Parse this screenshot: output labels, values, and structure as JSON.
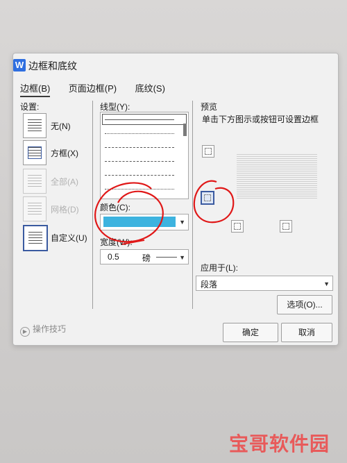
{
  "window": {
    "title": "边框和底纹",
    "app_icon": "W"
  },
  "tabs": [
    {
      "label": "边框(B)",
      "active": true
    },
    {
      "label": "页面边框(P)",
      "active": false
    },
    {
      "label": "底纹(S)",
      "active": false
    }
  ],
  "settings": {
    "heading": "设置:",
    "items": [
      {
        "label": "无(N)",
        "enabled": true,
        "selected": false
      },
      {
        "label": "方框(X)",
        "enabled": true,
        "selected": false
      },
      {
        "label": "全部(A)",
        "enabled": false,
        "selected": false
      },
      {
        "label": "网格(D)",
        "enabled": false,
        "selected": false
      },
      {
        "label": "自定义(U)",
        "enabled": true,
        "selected": true
      }
    ]
  },
  "line_style": {
    "heading": "线型(Y):",
    "selected_index": 0
  },
  "color": {
    "label": "颜色(C):",
    "value_hex": "#3db3df"
  },
  "width": {
    "label": "宽度(W):",
    "value": "0.5",
    "unit": "磅"
  },
  "preview": {
    "heading": "预览",
    "hint": "单击下方图示或按钮可设置边框"
  },
  "apply_to": {
    "label": "应用于(L):",
    "value": "段落"
  },
  "buttons": {
    "options": "选项(O)...",
    "ok": "确定",
    "cancel": "取消"
  },
  "tips": {
    "label": "操作技巧"
  },
  "watermark": {
    "brand": "宝哥软件园"
  },
  "colors": {
    "accent": "#3a5aa0",
    "annotation": "#e01818"
  }
}
